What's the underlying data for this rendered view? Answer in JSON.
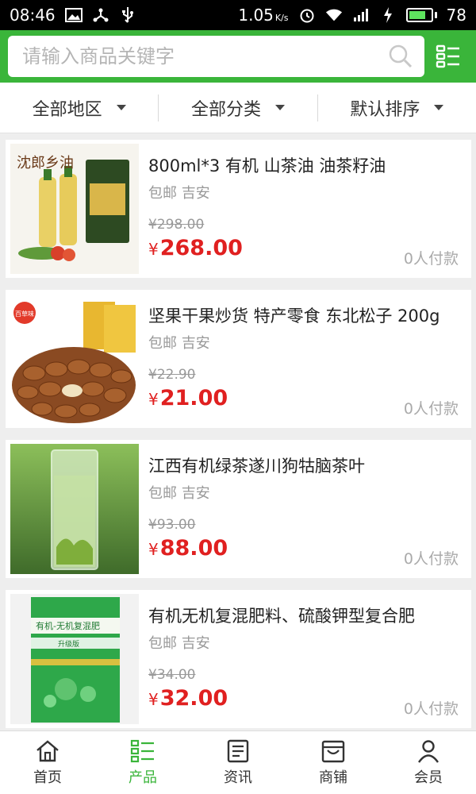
{
  "status_bar": {
    "time": "08:46",
    "network_speed": "1.05",
    "network_unit": "K/s",
    "battery": "78"
  },
  "search": {
    "placeholder": "请输入商品关键字"
  },
  "filters": [
    {
      "label": "全部地区"
    },
    {
      "label": "全部分类"
    },
    {
      "label": "默认排序"
    }
  ],
  "products": [
    {
      "title": "800ml*3 有机 山茶油 油茶籽油",
      "location": "包邮 吉安",
      "old_price": "¥298.00",
      "currency": "¥",
      "price": "268.00",
      "sold": "0人付款"
    },
    {
      "title": "坚果干果炒货 特产零食 东北松子 200g",
      "location": "包邮 吉安",
      "old_price": "¥22.90",
      "currency": "¥",
      "price": "21.00",
      "sold": "0人付款"
    },
    {
      "title": "江西有机绿茶遂川狗牯脑茶叶",
      "location": "包邮 吉安",
      "old_price": "¥93.00",
      "currency": "¥",
      "price": "88.00",
      "sold": "0人付款"
    },
    {
      "title": "有机无机复混肥料、硫酸钾型复合肥",
      "location": "包邮 吉安",
      "old_price": "¥34.00",
      "currency": "¥",
      "price": "32.00",
      "sold": "0人付款"
    }
  ],
  "product_images": {
    "oil_text": "沈郎乡油",
    "nut_brand": "百草味",
    "fert_title": "有机-无机复混肥",
    "fert_sub": "升级版"
  },
  "bottom_nav": [
    {
      "label": "首页",
      "icon": "home-icon"
    },
    {
      "label": "产品",
      "icon": "grid-list-icon"
    },
    {
      "label": "资讯",
      "icon": "news-icon"
    },
    {
      "label": "商铺",
      "icon": "shop-icon"
    },
    {
      "label": "会员",
      "icon": "user-icon"
    }
  ],
  "colors": {
    "brand_green": "#3ab53a",
    "price_red": "#e02020"
  }
}
